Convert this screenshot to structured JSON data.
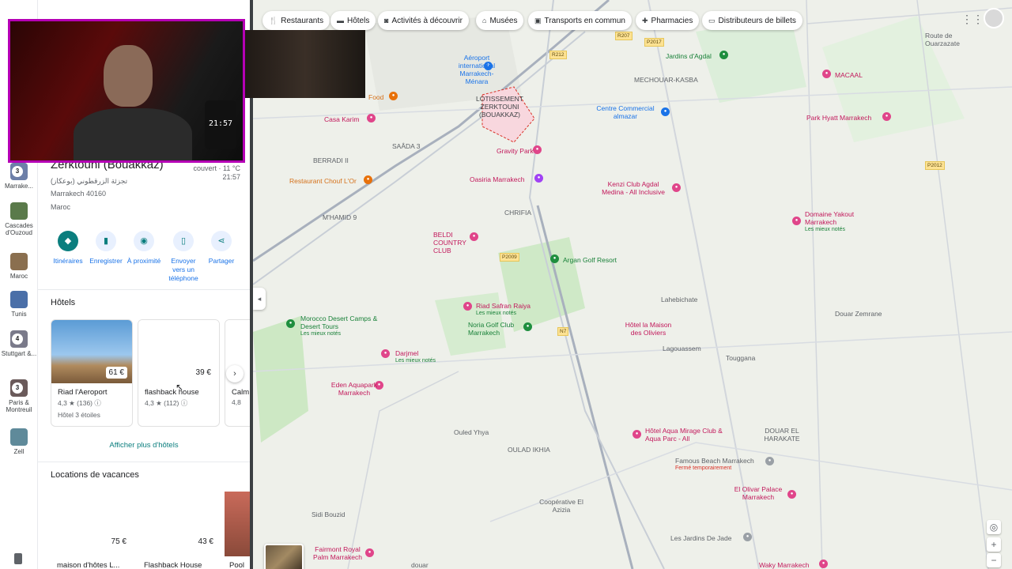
{
  "chips": [
    {
      "icon": "restaurant-icon",
      "label": "Restaurants"
    },
    {
      "icon": "hotel-icon",
      "label": "Hôtels"
    },
    {
      "icon": "camera-icon",
      "label": "Activités à découvrir"
    },
    {
      "icon": "museum-icon",
      "label": "Musées"
    },
    {
      "icon": "transit-icon",
      "label": "Transports en commun"
    },
    {
      "icon": "pharmacy-icon",
      "label": "Pharmacies"
    },
    {
      "icon": "ticket-icon",
      "label": "Distributeurs de billets"
    }
  ],
  "rail": [
    {
      "label": "Marrake...",
      "badge": "3",
      "color": "#6d7fa8"
    },
    {
      "label": "Cascades d'Ouzoud",
      "color": "#5a7a4a"
    },
    {
      "label": "Maroc",
      "color": "#8a6f4f"
    },
    {
      "label": "Tunis",
      "color": "#4a6fa8"
    },
    {
      "label": "Stuttgart &...",
      "badge": "4",
      "color": "#7a7a8a"
    },
    {
      "label": "Paris & Montreuil",
      "badge": "3",
      "color": "#6a5a5a"
    },
    {
      "label": "Zell",
      "color": "#5f8a9a"
    }
  ],
  "place": {
    "title": "Zerktouni (Bouakkaz)",
    "arabic": "تجزئة الزرقطوني (بوعكاز)",
    "city": "Marrakech 40160",
    "country": "Maroc",
    "weather": "couvert · 11 °C",
    "time": "21:57"
  },
  "actions": [
    {
      "label": "Itinéraires",
      "icon": "directions-icon"
    },
    {
      "label": "Enregistrer",
      "icon": "bookmark-icon"
    },
    {
      "label": "À proximité",
      "icon": "nearby-icon"
    },
    {
      "label": "Envoyer vers un téléphone",
      "icon": "phone-icon"
    },
    {
      "label": "Partager",
      "icon": "share-icon"
    }
  ],
  "hotels": {
    "title": "Hôtels",
    "more": "Afficher plus d'hôtels",
    "cards": [
      {
        "name": "Riad l'Aeroport",
        "price": "61 €",
        "rating": "4,3 ★ (136) ⓘ",
        "sub": "Hôtel 3 étoiles"
      },
      {
        "name": "flashback house",
        "price": "39 €",
        "rating": "4,3 ★ (112) ⓘ",
        "sub": ""
      },
      {
        "name": "Calm",
        "price": "",
        "rating": "4,8",
        "sub": ""
      }
    ]
  },
  "vacation": {
    "title": "Locations de vacances",
    "cards": [
      {
        "name": "maison d'hôtes L...",
        "price": "75 €"
      },
      {
        "name": "Flashback House",
        "price": "43 €"
      },
      {
        "name": "Pool",
        "price": ""
      }
    ]
  },
  "webcam": {
    "clock": "21:57"
  },
  "map": {
    "labels": [
      {
        "text": "Aéroport international Marrakech-Ménara",
        "cls": "blue"
      },
      {
        "text": "LOTISSEMENT ZERKTOUNI (BOUAKKAZ)",
        "cls": "dark"
      },
      {
        "text": "Jardins d'Agdal",
        "cls": "green"
      },
      {
        "text": "MECHOUAR-KASBA",
        "cls": ""
      },
      {
        "text": "MACAAL",
        "cls": "pink"
      },
      {
        "text": "Centre Commercial almazar",
        "cls": "blue"
      },
      {
        "text": "Park Hyatt Marrakech",
        "cls": "pink"
      },
      {
        "text": "Food",
        "cls": "orange"
      },
      {
        "text": "Casa Karim",
        "cls": "pink"
      },
      {
        "text": "SAÂDA 3",
        "cls": ""
      },
      {
        "text": "Gravity Park",
        "cls": "pink"
      },
      {
        "text": "BERRADI II",
        "cls": ""
      },
      {
        "text": "Oasiria Marrakech",
        "cls": "pink"
      },
      {
        "text": "Kenzi Club Agdal Medina - All Inclusive",
        "cls": "pink"
      },
      {
        "text": "Restaurant Chouf L'Or",
        "cls": "orange"
      },
      {
        "text": "M'HAMID 9",
        "cls": ""
      },
      {
        "text": "CHRIFIA",
        "cls": ""
      },
      {
        "text": "Domaine Yakout Marrakech",
        "cls": "pink"
      },
      {
        "text": "BELDI COUNTRY CLUB",
        "cls": "pink"
      },
      {
        "text": "Argan Golf Resort",
        "cls": "green"
      },
      {
        "text": "Lahebichate",
        "cls": ""
      },
      {
        "text": "Riad Safran Raiya",
        "cls": "pink"
      },
      {
        "text": "Noria Golf Club Marrakech",
        "cls": "green"
      },
      {
        "text": "Hôtel la Maison des Oliviers",
        "cls": "pink"
      },
      {
        "text": "Douar Zemrane",
        "cls": ""
      },
      {
        "text": "Morocco Desert Camps & Desert Tours",
        "cls": "green"
      },
      {
        "text": "Lagouassem",
        "cls": ""
      },
      {
        "text": "Touggana",
        "cls": ""
      },
      {
        "text": "Darjmel",
        "cls": "pink"
      },
      {
        "text": "Eden Aquapark Marrakech",
        "cls": "pink"
      },
      {
        "text": "Ouled Yhya",
        "cls": ""
      },
      {
        "text": "OULAD IKHIA",
        "cls": ""
      },
      {
        "text": "Hôtel Aqua Mirage Club & Aqua Parc - All",
        "cls": "pink"
      },
      {
        "text": "DOUAR EL HARAKATE",
        "cls": ""
      },
      {
        "text": "Famous Beach Marrakech",
        "cls": ""
      },
      {
        "text": "El Olivar Palace Marrakech",
        "cls": "pink"
      },
      {
        "text": "Sidi Bouzid",
        "cls": ""
      },
      {
        "text": "Coopérative El Azizia",
        "cls": ""
      },
      {
        "text": "Les Jardins De Jade",
        "cls": ""
      },
      {
        "text": "Fairmont Royal Palm Marrakech",
        "cls": "pink"
      },
      {
        "text": "Waky Marrakech",
        "cls": "pink"
      },
      {
        "text": "douar",
        "cls": ""
      },
      {
        "text": "Route de Ouarzazate",
        "cls": ""
      }
    ],
    "subs": [
      "Les mieux notés",
      "Fermé temporairement"
    ],
    "roads": [
      "P2017",
      "R212",
      "P2009",
      "R207",
      "P2012",
      "N7"
    ]
  }
}
